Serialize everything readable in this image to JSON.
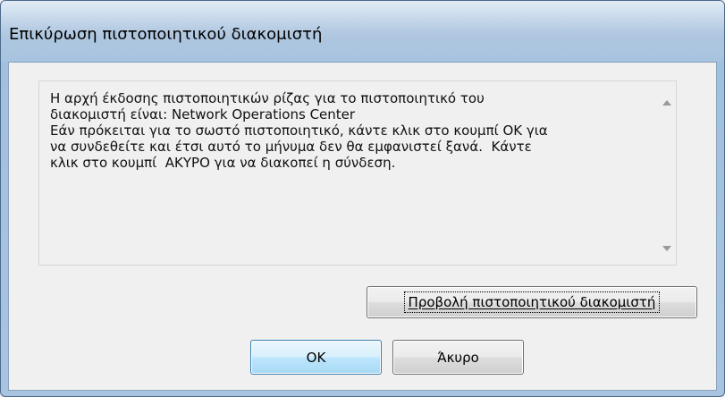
{
  "window": {
    "title": "Επικύρωση πιστοποιητικού διακομιστή"
  },
  "message": {
    "text": "Η αρχή έκδοσης πιστοποιητικών ρίζας για το πιστοποιητικό του\nδιακομιστή είναι: Network Operations Center\nΕάν πρόκειται για το σωστό πιστοποιητικό, κάντε κλικ στο κουμπί ΟΚ για\nνα συνδεθείτε και έτσι αυτό το μήνυμα δεν θα εμφανιστεί ξανά.  Κάντε\nκλικ στο κουμπί  ΑΚΥΡΟ για να διακοπεί η σύνδεση."
  },
  "scrollbar": {
    "up_icon": "scroll-up-arrow",
    "down_icon": "scroll-down-arrow"
  },
  "buttons": {
    "view_certificate": "Προβολή πιστοποιητικού διακομιστή",
    "ok": "OK",
    "cancel": "Άκυρο"
  },
  "colors": {
    "title_bar": "#a9c3df",
    "dialog_background": "#f0f0f0",
    "default_button": "#bee6fd"
  }
}
